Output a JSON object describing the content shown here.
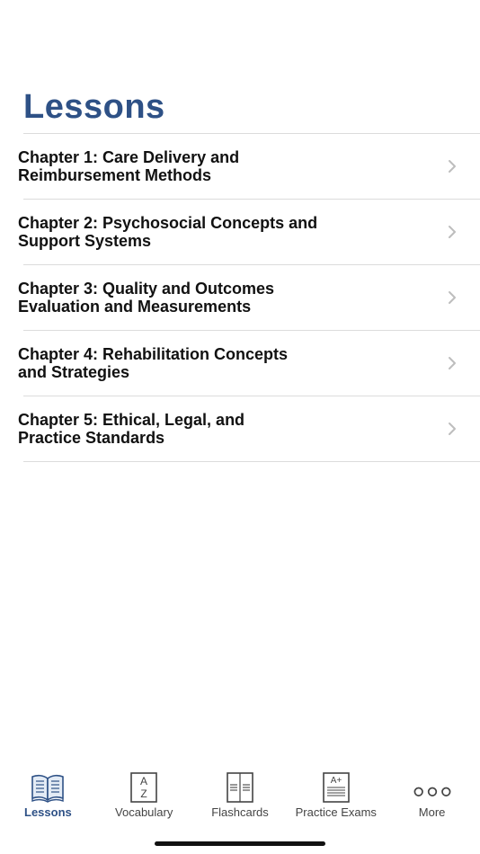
{
  "header": {
    "title": "Lessons"
  },
  "lessons": [
    {
      "line1": "Chapter 1: Care Delivery and",
      "line2": "Reimbursement Methods"
    },
    {
      "line1": "Chapter 2: Psychosocial Concepts and",
      "line2": "Support Systems"
    },
    {
      "line1": "Chapter 3: Quality and Outcomes",
      "line2": "Evaluation and Measurements"
    },
    {
      "line1": "Chapter 4: Rehabilitation Concepts",
      "line2": "and Strategies"
    },
    {
      "line1": "Chapter 5: Ethical, Legal, and",
      "line2": "Practice Standards"
    }
  ],
  "tabbar": {
    "tabs": [
      {
        "label": "Lessons",
        "icon": "book-icon",
        "active": true
      },
      {
        "label": "Vocabulary",
        "icon": "az-icon",
        "active": false
      },
      {
        "label": "Flashcards",
        "icon": "flashcards-icon",
        "active": false
      },
      {
        "label": "Practice Exams",
        "icon": "exam-icon",
        "active": false
      },
      {
        "label": "More",
        "icon": "more-icon",
        "active": false
      }
    ],
    "az_icon_text": [
      "A",
      "Z"
    ],
    "exam_icon_text": "A+"
  },
  "colors": {
    "accent": "#2e5186",
    "divider": "#dcdcdc",
    "chevron": "#bdbdbd",
    "tab_inactive": "#444444"
  }
}
